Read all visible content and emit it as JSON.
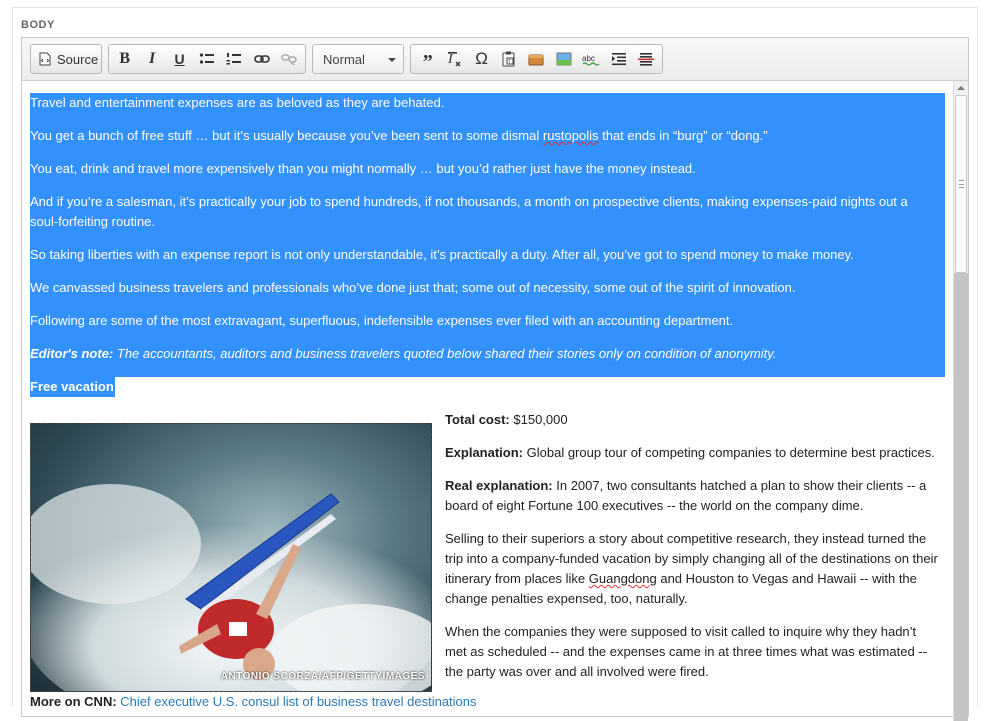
{
  "field": {
    "label": "BODY"
  },
  "toolbar": {
    "source_label": "Source",
    "format_select": "Normal",
    "icons": [
      "source-icon",
      "bold-icon",
      "italic-icon",
      "underline-icon",
      "bulleted-list-icon",
      "numbered-list-icon",
      "link-icon",
      "unlink-icon",
      "blockquote-icon",
      "remove-format-icon",
      "special-character-icon",
      "paste-text-icon",
      "template-icon",
      "image-icon",
      "spellcheck-icon",
      "indent-icon",
      "strikethrough-icon"
    ],
    "labels": {
      "bold": "B",
      "italic": "I",
      "underline": "U",
      "omega": "Ω",
      "quote": "99",
      "remove_format": "I"
    }
  },
  "selection_color": "#3390ff",
  "content": {
    "selected_paragraphs": [
      "Travel and entertainment expenses are as beloved as they are behated.",
      "You get a bunch of free stuff … but it’s usually because you’ve been sent to some dismal rustopolis that ends in “burg” or “dong.”",
      "You eat, drink and travel more expensively than you might normally … but you’d rather just have the money instead.",
      "And if you’re a salesman, it’s practically your job to spend hundreds, if not thousands, a month on prospective clients, making expenses-paid nights out a",
      "soul-forfeiting routine.",
      "So taking liberties with an expense report is not only understandable, it’s practically a duty. After all, you’ve got to spend money to make money.",
      "We canvassed business travelers and professionals who’ve done just that; some out of necessity, some out of the spirit of innovation.",
      "Following are some of the most extravagant, superfluous, indefensible expenses ever filed with an accounting department."
    ],
    "editors_note_label": "Editor's note:",
    "editors_note_text": " The accountants, auditors and business travelers quoted below shared their stories only on condition of anonymity.",
    "heading": "Free vacation",
    "photo_credit": "ANTONIO SCORZA/AFP/GETTYIMAGES",
    "total_cost_label": "Total cost:",
    "total_cost_value": " $150,000",
    "explanation_label": "Explanation:",
    "explanation_text": " Global group tour of competing companies to determine best practices.",
    "real_label": "Real explanation:",
    "real_line1": " In 2007, two consultants hatched a plan to show their clients -- a",
    "real_line2": "board of eight Fortune 100 executives -- the world on the company dime.",
    "selling_line1": "Selling to their superiors a story about competitive research, they instead turned the",
    "selling_line2": "trip into a company-funded vacation by simply changing all of the destinations on their",
    "selling_line3a": "itinerary from places like ",
    "selling_line3b": "Guangdong",
    "selling_line3c": " and Houston to Vegas and Hawaii -- with the",
    "selling_line4": "change penalties expensed, too, naturally.",
    "when_line1": "When the companies they were supposed to visit called to inquire why they hadn’t",
    "when_line2": "met as scheduled -- and the expenses came in at three times what was estimated --",
    "when_line3": "the party was over and all involved were fired.",
    "more_label": "More on CNN:",
    "more_link": " Chief executive U.S. consul list of business travel destinations"
  }
}
